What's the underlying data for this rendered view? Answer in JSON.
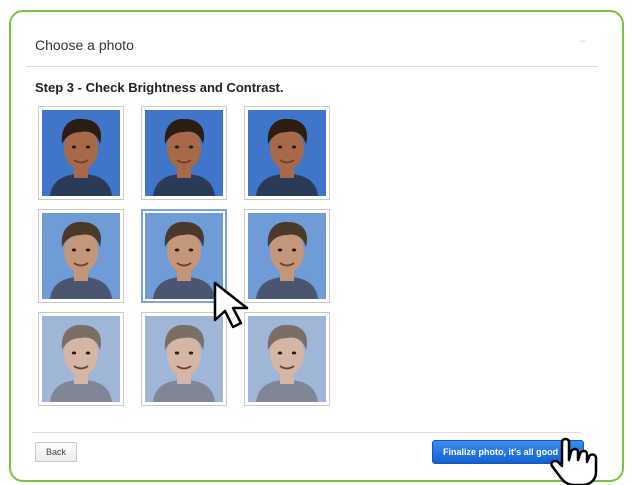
{
  "dialog": {
    "title": "Choose a photo",
    "step_title": "Step 3 - Check Brightness and Contrast."
  },
  "photos": [
    {
      "label": "",
      "brightness": "dark"
    },
    {
      "label": "",
      "brightness": "dark"
    },
    {
      "label": "",
      "brightness": "dark"
    },
    {
      "label": "",
      "brightness": "normal"
    },
    {
      "label": "",
      "brightness": "normal",
      "selected": true
    },
    {
      "label": "",
      "brightness": "normal"
    },
    {
      "label": "",
      "brightness": "light"
    },
    {
      "label": "",
      "brightness": "light"
    },
    {
      "label": "",
      "brightness": "light"
    }
  ],
  "footer": {
    "back_label": "Back",
    "finalize_label": "Finalize photo, it's all good"
  },
  "colors": {
    "frame_border": "#7cc242",
    "accent_button": "#1460d2",
    "selected_border": "#7da2e8",
    "photo_background": "#5b8fd3"
  },
  "icons": [
    "close-icon",
    "arrow-cursor-icon",
    "hand-cursor-icon"
  ]
}
